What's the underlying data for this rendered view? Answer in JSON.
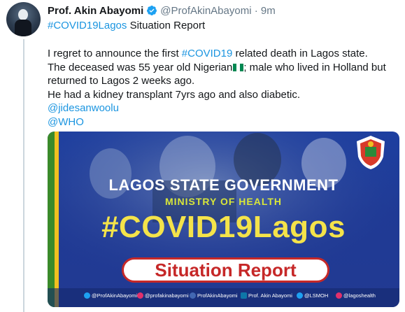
{
  "tweet": {
    "author_name": "Prof. Akin Abayomi",
    "handle": "@ProfAkinAbayomi",
    "separator": "·",
    "time": "9m",
    "report_hashtag": "#COVID19Lagos",
    "report_text": " Situation Report",
    "line1_a": "I regret to announce the first ",
    "line1_hashtag": "#COVID19",
    "line1_b": " related death in Lagos state.",
    "line2": "The deceased was 55 year old Nigerian",
    "line2_b": "; male who lived in Holland but",
    "line3": "returned to Lagos 2 weeks ago.",
    "line4": "He had a kidney transplant 7yrs ago and also diabetic.",
    "mention1": "@jidesanwoolu",
    "mention2": "@WHO"
  },
  "card": {
    "government": "LAGOS STATE GOVERNMENT",
    "ministry": "MINISTRY OF HEALTH",
    "hashtag": "#COVID19Lagos",
    "situation_report": "Situation Report",
    "socials": [
      {
        "icon": "twitter-icon",
        "label": "@ProfAkinAbayomi"
      },
      {
        "icon": "instagram-icon",
        "label": "@profakinabayomi"
      },
      {
        "icon": "facebook-icon",
        "label": "ProfAkinAbayomi"
      },
      {
        "icon": "linkedin-icon",
        "label": "Prof. Akin Abayomi"
      },
      {
        "icon": "twitter-icon",
        "label": "@LSMOH"
      },
      {
        "icon": "instagram-icon",
        "label": "@lagoshealth"
      }
    ]
  },
  "colors": {
    "link": "#1b95e0",
    "card_blue": "#1f3a95",
    "headline_yellow": "#f4e34a",
    "report_red": "#c62828"
  }
}
